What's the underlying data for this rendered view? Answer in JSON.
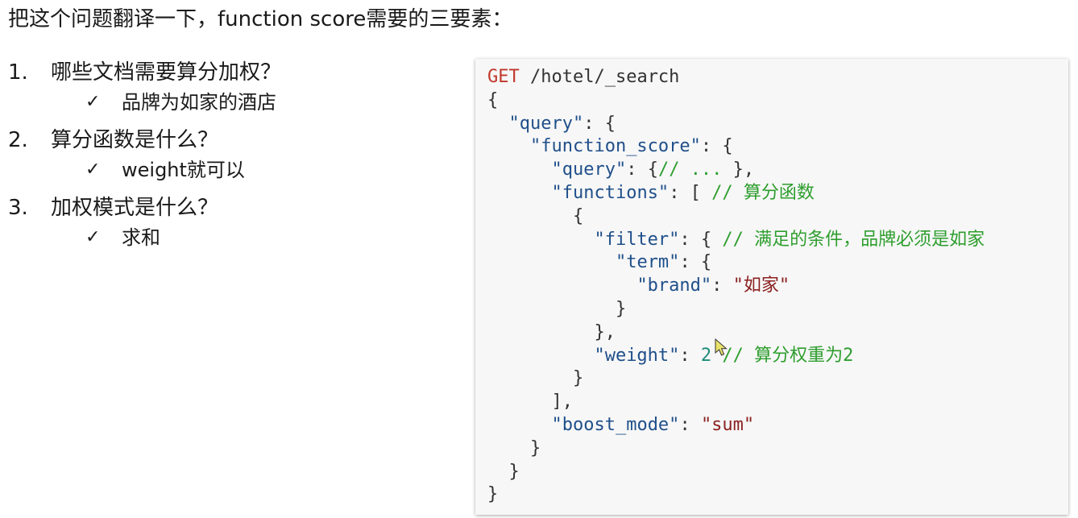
{
  "heading": "把这个问题翻译一下，function score需要的三要素：",
  "check_mark": "✓",
  "qa": [
    {
      "number": "1.",
      "question": "哪些文档需要算分加权？",
      "answer": "品牌为如家的酒店"
    },
    {
      "number": "2.",
      "question": "算分函数是什么？",
      "answer": "weight就可以"
    },
    {
      "number": "3.",
      "question": "加权模式是什么？",
      "answer": "求和"
    }
  ],
  "code": {
    "colors": {
      "method": "#c0392b",
      "key": "#1f4f8a",
      "string": "#8b2020",
      "number": "#1e8c7a",
      "comment": "#2e9e2e",
      "default": "#333333"
    },
    "lines": [
      [
        {
          "t": "method",
          "v": "GET"
        },
        {
          "t": "default",
          "v": " /hotel/_search"
        }
      ],
      [
        {
          "t": "default",
          "v": "{"
        }
      ],
      [
        {
          "t": "default",
          "v": "  "
        },
        {
          "t": "key",
          "v": "\"query\""
        },
        {
          "t": "default",
          "v": ": {"
        }
      ],
      [
        {
          "t": "default",
          "v": "    "
        },
        {
          "t": "key",
          "v": "\"function_score\""
        },
        {
          "t": "default",
          "v": ": {"
        }
      ],
      [
        {
          "t": "default",
          "v": "      "
        },
        {
          "t": "key",
          "v": "\"query\""
        },
        {
          "t": "default",
          "v": ": {"
        },
        {
          "t": "comment",
          "v": "// ..."
        },
        {
          "t": "default",
          "v": " },"
        }
      ],
      [
        {
          "t": "default",
          "v": "      "
        },
        {
          "t": "key",
          "v": "\"functions\""
        },
        {
          "t": "default",
          "v": ": [ "
        },
        {
          "t": "comment",
          "v": "// 算分函数"
        }
      ],
      [
        {
          "t": "default",
          "v": "        {"
        }
      ],
      [
        {
          "t": "default",
          "v": "          "
        },
        {
          "t": "key",
          "v": "\"filter\""
        },
        {
          "t": "default",
          "v": ": { "
        },
        {
          "t": "comment",
          "v": "// 满足的条件，品牌必须是如家"
        }
      ],
      [
        {
          "t": "default",
          "v": "            "
        },
        {
          "t": "key",
          "v": "\"term\""
        },
        {
          "t": "default",
          "v": ": {"
        }
      ],
      [
        {
          "t": "default",
          "v": "              "
        },
        {
          "t": "key",
          "v": "\"brand\""
        },
        {
          "t": "default",
          "v": ": "
        },
        {
          "t": "string",
          "v": "\"如家\""
        }
      ],
      [
        {
          "t": "default",
          "v": "            }"
        }
      ],
      [
        {
          "t": "default",
          "v": "          },"
        }
      ],
      [
        {
          "t": "default",
          "v": "          "
        },
        {
          "t": "key",
          "v": "\"weight\""
        },
        {
          "t": "default",
          "v": ": "
        },
        {
          "t": "number",
          "v": "2"
        },
        {
          "t": "default",
          "v": " "
        },
        {
          "t": "comment",
          "v": "// 算分权重为2"
        }
      ],
      [
        {
          "t": "default",
          "v": "        }"
        }
      ],
      [
        {
          "t": "default",
          "v": "      ],"
        }
      ],
      [
        {
          "t": "default",
          "v": "      "
        },
        {
          "t": "key",
          "v": "\"boost_mode\""
        },
        {
          "t": "default",
          "v": ": "
        },
        {
          "t": "string",
          "v": "\"sum\""
        }
      ],
      [
        {
          "t": "default",
          "v": "    }"
        }
      ],
      [
        {
          "t": "default",
          "v": "  }"
        }
      ],
      [
        {
          "t": "default",
          "v": "}"
        }
      ]
    ]
  }
}
